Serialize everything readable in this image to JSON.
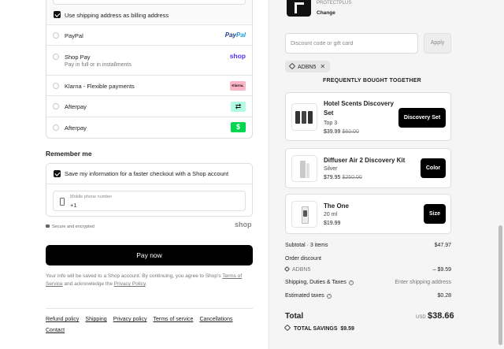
{
  "billing": {
    "same_as_shipping_label": "Use shipping address as billing address"
  },
  "payment_methods": [
    {
      "label": "PayPal",
      "sub": "",
      "logo": "PayPal"
    },
    {
      "label": "Shop Pay",
      "sub": "Pay in full or in installments",
      "logo": "shop"
    },
    {
      "label": "Klarna - Flexible payments",
      "sub": "",
      "logo": "Klarna."
    },
    {
      "label": "Afterpay",
      "sub": "",
      "logo": "afterpay-icon"
    },
    {
      "label": "Afterpay",
      "sub": "",
      "logo": "cash-app-icon"
    }
  ],
  "remember": {
    "title": "Remember me",
    "save_label": "Save my information for a faster checkout with a Shop account",
    "phone_placeholder": "Mobile phone number",
    "phone_value": "+1"
  },
  "secure_text": "Secure and encrypted",
  "shop_logo": "shop",
  "pay_now_label": "Pay now",
  "disclaimer": {
    "text1": "Your info will be saved to a Shop account. By continuing, you agree to Shop's ",
    "terms_link": "Terms of Service",
    "text2": " and acknowledge the ",
    "privacy_link": "Privacy Policy",
    "text3": "."
  },
  "footer_links": [
    "Refund policy",
    "Shipping",
    "Privacy policy",
    "Terms of service",
    "Cancellations",
    "Contact"
  ],
  "summary_top": {
    "protect_label": "PROTECTPLUS",
    "change_label": "Change"
  },
  "discount": {
    "placeholder": "Discount code or gift card",
    "apply_label": "Apply",
    "applied_code": "ADBN5"
  },
  "fbt": {
    "title": "FREQUENTLY BOUGHT TOGETHER",
    "products": [
      {
        "name": "Hotel Scents Discovery Set",
        "variant": "Top 3",
        "price": "$39.99",
        "compare": "$60.00",
        "button": "Discovery Set"
      },
      {
        "name": "Diffuser Air 2 Discovery Kit",
        "variant": "Silver",
        "price": "$79.95",
        "compare": "$250.00",
        "button": "Color"
      },
      {
        "name": "The One",
        "variant": "20 ml",
        "price": "$19.99",
        "compare": "",
        "button": "Size"
      }
    ]
  },
  "summary": {
    "subtotal_label": "Subtotal · 3 items",
    "subtotal_value": "$47.97",
    "order_discount_label": "Order discount",
    "discount_code": "ADBN5",
    "discount_value": "– $9.59",
    "shipping_label": "Shipping, Duties & Taxes",
    "shipping_value": "Enter shipping address",
    "taxes_label": "Estimated taxes",
    "taxes_value": "$0.28",
    "total_label": "Total",
    "total_currency": "USD",
    "total_value": "$38.66",
    "savings_label": "TOTAL SAVINGS",
    "savings_value": "$9.59"
  }
}
